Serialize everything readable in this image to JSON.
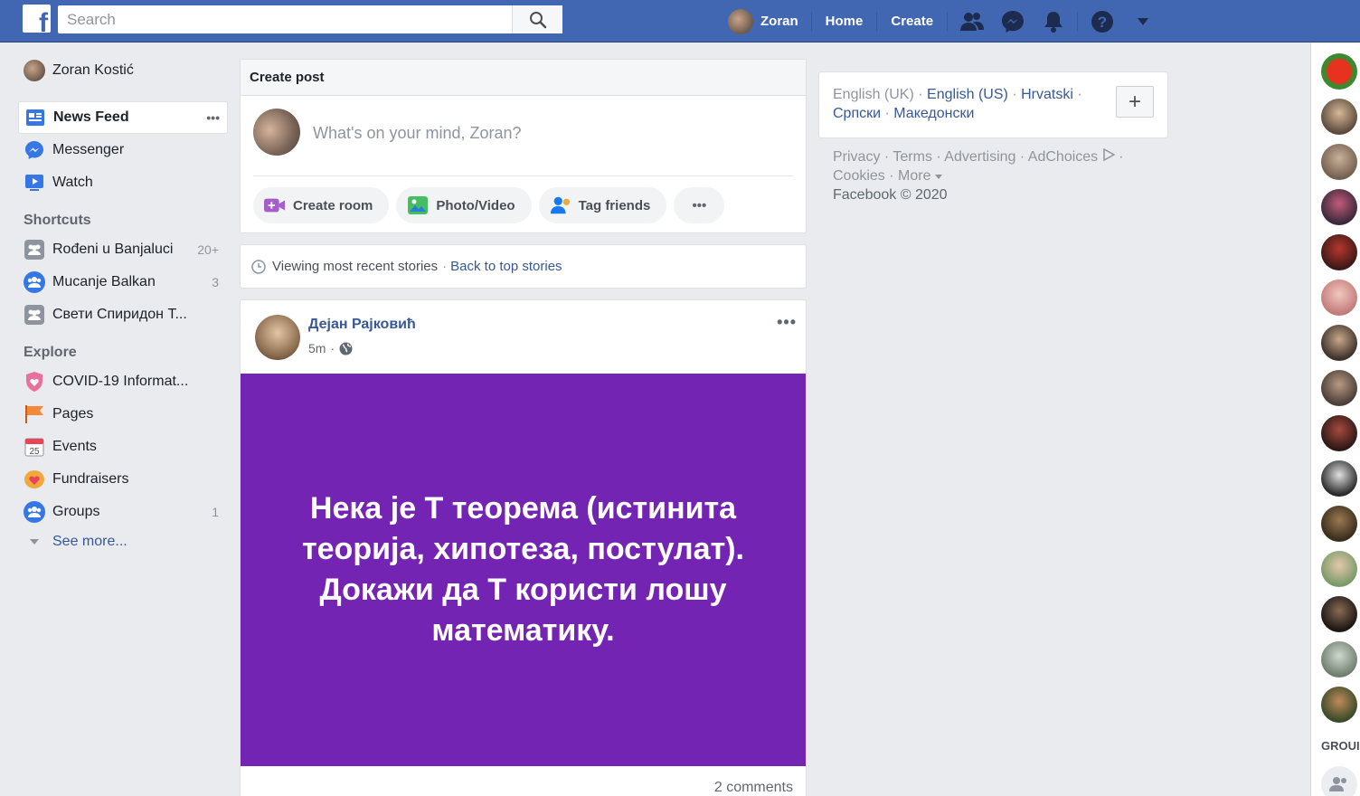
{
  "topbar": {
    "logo_letter": "f",
    "search_placeholder": "Search",
    "user_name": "Zoran",
    "home": "Home",
    "create": "Create"
  },
  "left": {
    "profile_name": "Zoran Kostić",
    "main": [
      {
        "label": "News Feed",
        "icon": "news-feed-icon"
      },
      {
        "label": "Messenger",
        "icon": "messenger-icon"
      },
      {
        "label": "Watch",
        "icon": "watch-icon"
      }
    ],
    "news_feed_more": "•••",
    "shortcuts_title": "Shortcuts",
    "shortcuts": [
      {
        "label": "Rođeni u Banjaluci",
        "count": "20+"
      },
      {
        "label": "Mucanje Balkan",
        "count": "3"
      },
      {
        "label": "Свети Спиридон Т...",
        "count": ""
      }
    ],
    "explore_title": "Explore",
    "explore": [
      {
        "label": "COVID-19 Informat...",
        "count": ""
      },
      {
        "label": "Pages",
        "count": ""
      },
      {
        "label": "Events",
        "count": ""
      },
      {
        "label": "Fundraisers",
        "count": ""
      },
      {
        "label": "Groups",
        "count": "1"
      }
    ],
    "see_more": "See more..."
  },
  "create_post": {
    "title": "Create post",
    "placeholder": "What's on your mind, Zoran?",
    "actions": [
      "Create room",
      "Photo/Video",
      "Tag friends"
    ],
    "more": "•••"
  },
  "recent": {
    "text": "Viewing most recent stories",
    "sep": "·",
    "link": "Back to top stories"
  },
  "post": {
    "author": "Дејан Рајковић",
    "time": "5m",
    "sep": "·",
    "menu": "•••",
    "body": "Нека је Т теорема (истинита теорија, хипотеза, постулат). Докажи да Т користи лошу математику.",
    "comments": "2 comments",
    "bg_color": "#7424b2"
  },
  "right": {
    "lang_current": "English (UK)",
    "langs": [
      "English (US)",
      "Hrvatski",
      "Српски",
      "Македонски"
    ],
    "lang_add": "+",
    "footer": [
      "Privacy",
      "Terms",
      "Advertising",
      "AdChoices",
      "Cookies",
      "More"
    ],
    "copyright": "Facebook © 2020"
  },
  "chat": {
    "groups_label": "GROUI"
  }
}
